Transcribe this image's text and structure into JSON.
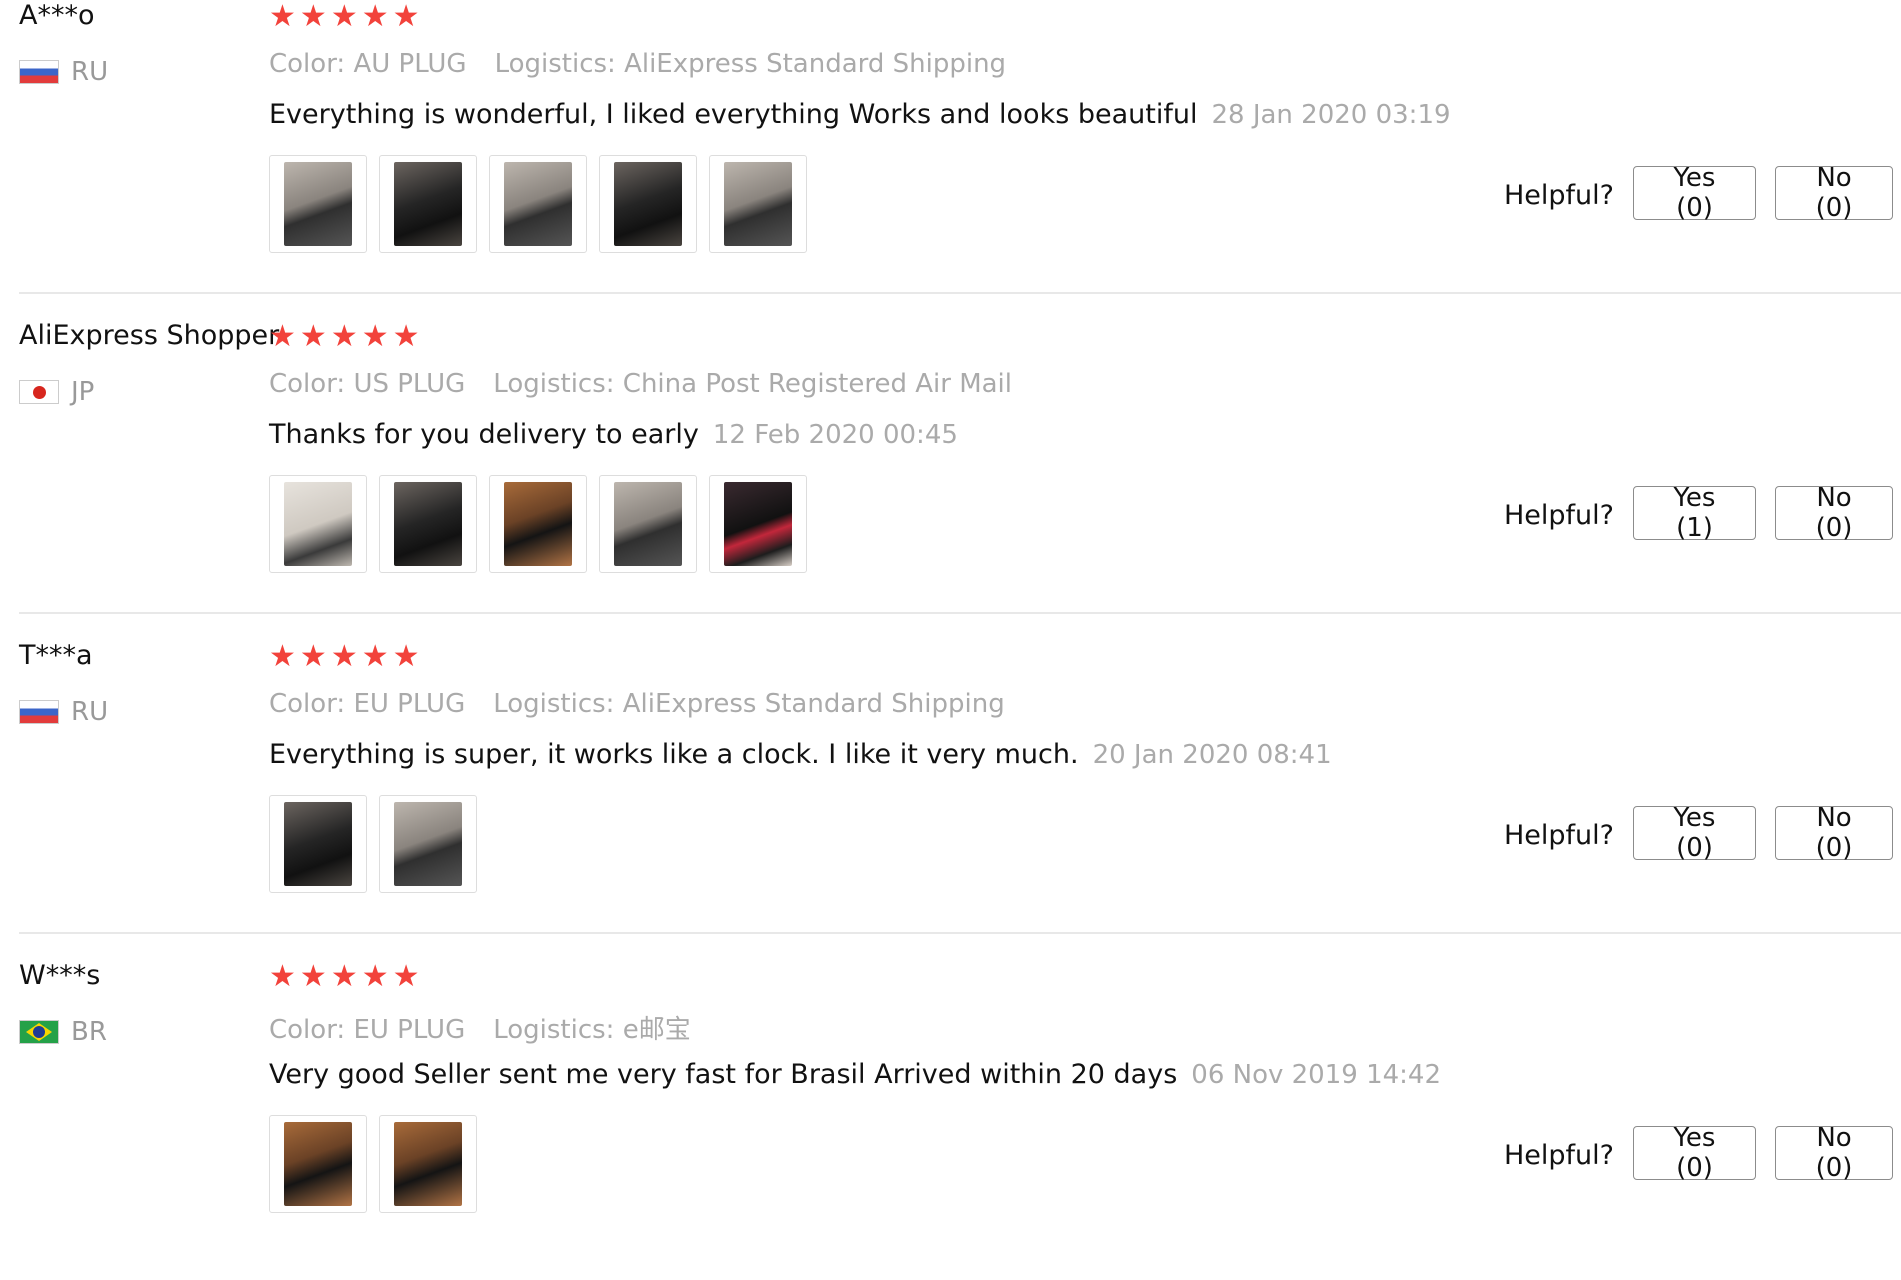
{
  "reviews": [
    {
      "name": "A***o",
      "country": "RU",
      "flag": "russia-flag",
      "rating": 5,
      "color_label": "Color: AU PLUG",
      "logistics_label": "Logistics: AliExpress Standard Shipping",
      "text": "Everything is wonderful, I liked everything Works and looks beautiful",
      "date": "28 Jan 2020 03:19",
      "photo_count": 5,
      "helpful_label": "Helpful?",
      "yes_label": "Yes (0)",
      "no_label": "No (0)"
    },
    {
      "name": "AliExpress Shopper",
      "country": "JP",
      "flag": "japan-flag",
      "rating": 5,
      "color_label": "Color: US PLUG",
      "logistics_label": "Logistics: China Post Registered Air Mail",
      "text": "Thanks for you delivery to early",
      "date": "12 Feb 2020 00:45",
      "photo_count": 5,
      "helpful_label": "Helpful?",
      "yes_label": "Yes (1)",
      "no_label": "No (0)"
    },
    {
      "name": "T***a",
      "country": "RU",
      "flag": "russia-flag",
      "rating": 5,
      "color_label": "Color: EU PLUG",
      "logistics_label": "Logistics: AliExpress Standard Shipping",
      "text": "Everything is super, it works like a clock. I like it very much.",
      "date": "20 Jan 2020 08:41",
      "photo_count": 2,
      "helpful_label": "Helpful?",
      "yes_label": "Yes (0)",
      "no_label": "No (0)"
    },
    {
      "name": "W***s",
      "country": "BR",
      "flag": "brazil-flag",
      "rating": 5,
      "color_label": "Color: EU PLUG",
      "logistics_label": "Logistics: e邮宝",
      "text": "Very good Seller sent me very fast for Brasil Arrived within 20 days",
      "date": "06 Nov 2019 14:42",
      "photo_count": 2,
      "helpful_label": "Helpful?",
      "yes_label": "Yes (0)",
      "no_label": "No (0)"
    }
  ],
  "colors": {
    "star": "#f2423b",
    "muted_text": "#aaaaaa",
    "divider": "#e8e8e8",
    "button_border": "#8c8c8c"
  }
}
